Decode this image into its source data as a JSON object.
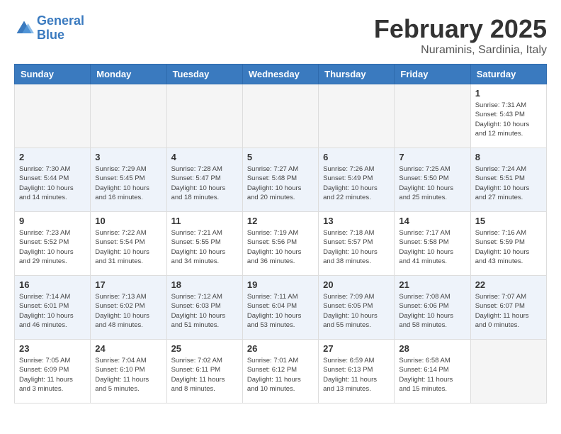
{
  "header": {
    "logo_line1": "General",
    "logo_line2": "Blue",
    "title": "February 2025",
    "subtitle": "Nuraminis, Sardinia, Italy"
  },
  "days_of_week": [
    "Sunday",
    "Monday",
    "Tuesday",
    "Wednesday",
    "Thursday",
    "Friday",
    "Saturday"
  ],
  "weeks": [
    [
      {
        "day": "",
        "info": ""
      },
      {
        "day": "",
        "info": ""
      },
      {
        "day": "",
        "info": ""
      },
      {
        "day": "",
        "info": ""
      },
      {
        "day": "",
        "info": ""
      },
      {
        "day": "",
        "info": ""
      },
      {
        "day": "1",
        "info": "Sunrise: 7:31 AM\nSunset: 5:43 PM\nDaylight: 10 hours and 12 minutes."
      }
    ],
    [
      {
        "day": "2",
        "info": "Sunrise: 7:30 AM\nSunset: 5:44 PM\nDaylight: 10 hours and 14 minutes."
      },
      {
        "day": "3",
        "info": "Sunrise: 7:29 AM\nSunset: 5:45 PM\nDaylight: 10 hours and 16 minutes."
      },
      {
        "day": "4",
        "info": "Sunrise: 7:28 AM\nSunset: 5:47 PM\nDaylight: 10 hours and 18 minutes."
      },
      {
        "day": "5",
        "info": "Sunrise: 7:27 AM\nSunset: 5:48 PM\nDaylight: 10 hours and 20 minutes."
      },
      {
        "day": "6",
        "info": "Sunrise: 7:26 AM\nSunset: 5:49 PM\nDaylight: 10 hours and 22 minutes."
      },
      {
        "day": "7",
        "info": "Sunrise: 7:25 AM\nSunset: 5:50 PM\nDaylight: 10 hours and 25 minutes."
      },
      {
        "day": "8",
        "info": "Sunrise: 7:24 AM\nSunset: 5:51 PM\nDaylight: 10 hours and 27 minutes."
      }
    ],
    [
      {
        "day": "9",
        "info": "Sunrise: 7:23 AM\nSunset: 5:52 PM\nDaylight: 10 hours and 29 minutes."
      },
      {
        "day": "10",
        "info": "Sunrise: 7:22 AM\nSunset: 5:54 PM\nDaylight: 10 hours and 31 minutes."
      },
      {
        "day": "11",
        "info": "Sunrise: 7:21 AM\nSunset: 5:55 PM\nDaylight: 10 hours and 34 minutes."
      },
      {
        "day": "12",
        "info": "Sunrise: 7:19 AM\nSunset: 5:56 PM\nDaylight: 10 hours and 36 minutes."
      },
      {
        "day": "13",
        "info": "Sunrise: 7:18 AM\nSunset: 5:57 PM\nDaylight: 10 hours and 38 minutes."
      },
      {
        "day": "14",
        "info": "Sunrise: 7:17 AM\nSunset: 5:58 PM\nDaylight: 10 hours and 41 minutes."
      },
      {
        "day": "15",
        "info": "Sunrise: 7:16 AM\nSunset: 5:59 PM\nDaylight: 10 hours and 43 minutes."
      }
    ],
    [
      {
        "day": "16",
        "info": "Sunrise: 7:14 AM\nSunset: 6:01 PM\nDaylight: 10 hours and 46 minutes."
      },
      {
        "day": "17",
        "info": "Sunrise: 7:13 AM\nSunset: 6:02 PM\nDaylight: 10 hours and 48 minutes."
      },
      {
        "day": "18",
        "info": "Sunrise: 7:12 AM\nSunset: 6:03 PM\nDaylight: 10 hours and 51 minutes."
      },
      {
        "day": "19",
        "info": "Sunrise: 7:11 AM\nSunset: 6:04 PM\nDaylight: 10 hours and 53 minutes."
      },
      {
        "day": "20",
        "info": "Sunrise: 7:09 AM\nSunset: 6:05 PM\nDaylight: 10 hours and 55 minutes."
      },
      {
        "day": "21",
        "info": "Sunrise: 7:08 AM\nSunset: 6:06 PM\nDaylight: 10 hours and 58 minutes."
      },
      {
        "day": "22",
        "info": "Sunrise: 7:07 AM\nSunset: 6:07 PM\nDaylight: 11 hours and 0 minutes."
      }
    ],
    [
      {
        "day": "23",
        "info": "Sunrise: 7:05 AM\nSunset: 6:09 PM\nDaylight: 11 hours and 3 minutes."
      },
      {
        "day": "24",
        "info": "Sunrise: 7:04 AM\nSunset: 6:10 PM\nDaylight: 11 hours and 5 minutes."
      },
      {
        "day": "25",
        "info": "Sunrise: 7:02 AM\nSunset: 6:11 PM\nDaylight: 11 hours and 8 minutes."
      },
      {
        "day": "26",
        "info": "Sunrise: 7:01 AM\nSunset: 6:12 PM\nDaylight: 11 hours and 10 minutes."
      },
      {
        "day": "27",
        "info": "Sunrise: 6:59 AM\nSunset: 6:13 PM\nDaylight: 11 hours and 13 minutes."
      },
      {
        "day": "28",
        "info": "Sunrise: 6:58 AM\nSunset: 6:14 PM\nDaylight: 11 hours and 15 minutes."
      },
      {
        "day": "",
        "info": ""
      }
    ]
  ]
}
